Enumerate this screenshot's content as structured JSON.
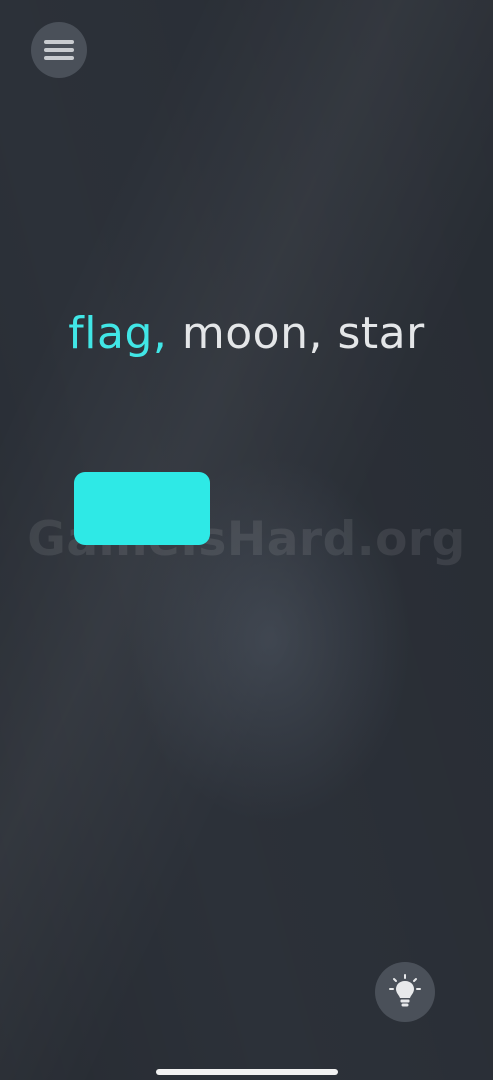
{
  "menu": {
    "icon": "hamburger-menu-icon"
  },
  "sentence": {
    "active_word": "flag,",
    "rest": "moon, star"
  },
  "shape": {
    "color": "#2ee9e6"
  },
  "watermark": {
    "text": "GameIsHard.org"
  },
  "hint": {
    "icon": "lightbulb-icon"
  },
  "colors": {
    "accent": "#41e6e6",
    "background": "#2c3139"
  }
}
